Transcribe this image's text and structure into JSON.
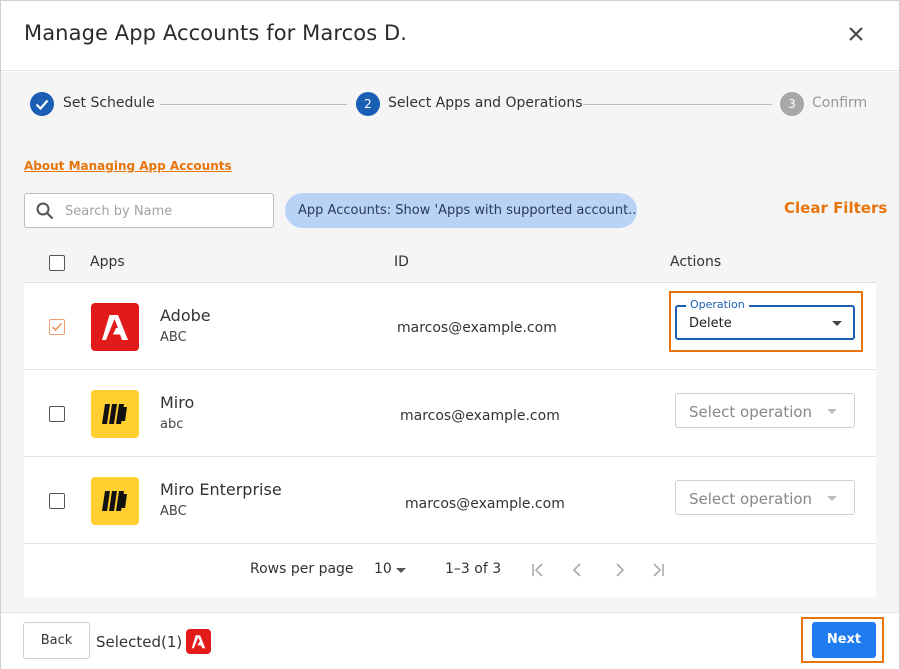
{
  "dialog": {
    "title": "Manage App Accounts for Marcos D.",
    "close_icon": "close-icon"
  },
  "stepper": {
    "steps": [
      {
        "number": "1",
        "label": "Set Schedule",
        "state": "completed"
      },
      {
        "number": "2",
        "label": "Select Apps and Operations",
        "state": "active"
      },
      {
        "number": "3",
        "label": "Confirm",
        "state": "pending"
      }
    ]
  },
  "about_link": "About Managing App Accounts",
  "search": {
    "placeholder": "Search by Name",
    "value": ""
  },
  "filter_chip": "App Accounts: Show 'Apps with supported account...",
  "clear_filters": "Clear Filters",
  "table": {
    "headers": {
      "apps": "Apps",
      "id": "ID",
      "actions": "Actions"
    },
    "rows": [
      {
        "app": "Adobe",
        "sub": "ABC",
        "id": "marcos@example.com",
        "checked": true,
        "icon": "adobe-icon",
        "operation_label": "Operation",
        "operation_value": "Delete"
      },
      {
        "app": "Miro",
        "sub": "abc",
        "id": "marcos@example.com",
        "checked": false,
        "icon": "miro-icon",
        "operation_placeholder": "Select operation"
      },
      {
        "app": "Miro Enterprise",
        "sub": "ABC",
        "id": "marcos@example.com",
        "checked": false,
        "icon": "miro-icon",
        "operation_placeholder": "Select operation"
      }
    ]
  },
  "pagination": {
    "rows_per_page_label": "Rows per page",
    "rows_per_page_value": "10",
    "range": "1–3 of 3"
  },
  "footer": {
    "back": "Back",
    "selected": "Selected(1)",
    "next": "Next"
  },
  "colors": {
    "accent_blue": "#1a5fb4",
    "orange": "#e8740c",
    "adobe_red": "#e31a1a",
    "miro_yellow": "#ffd02f",
    "chip_bg": "#b9d3f7"
  }
}
